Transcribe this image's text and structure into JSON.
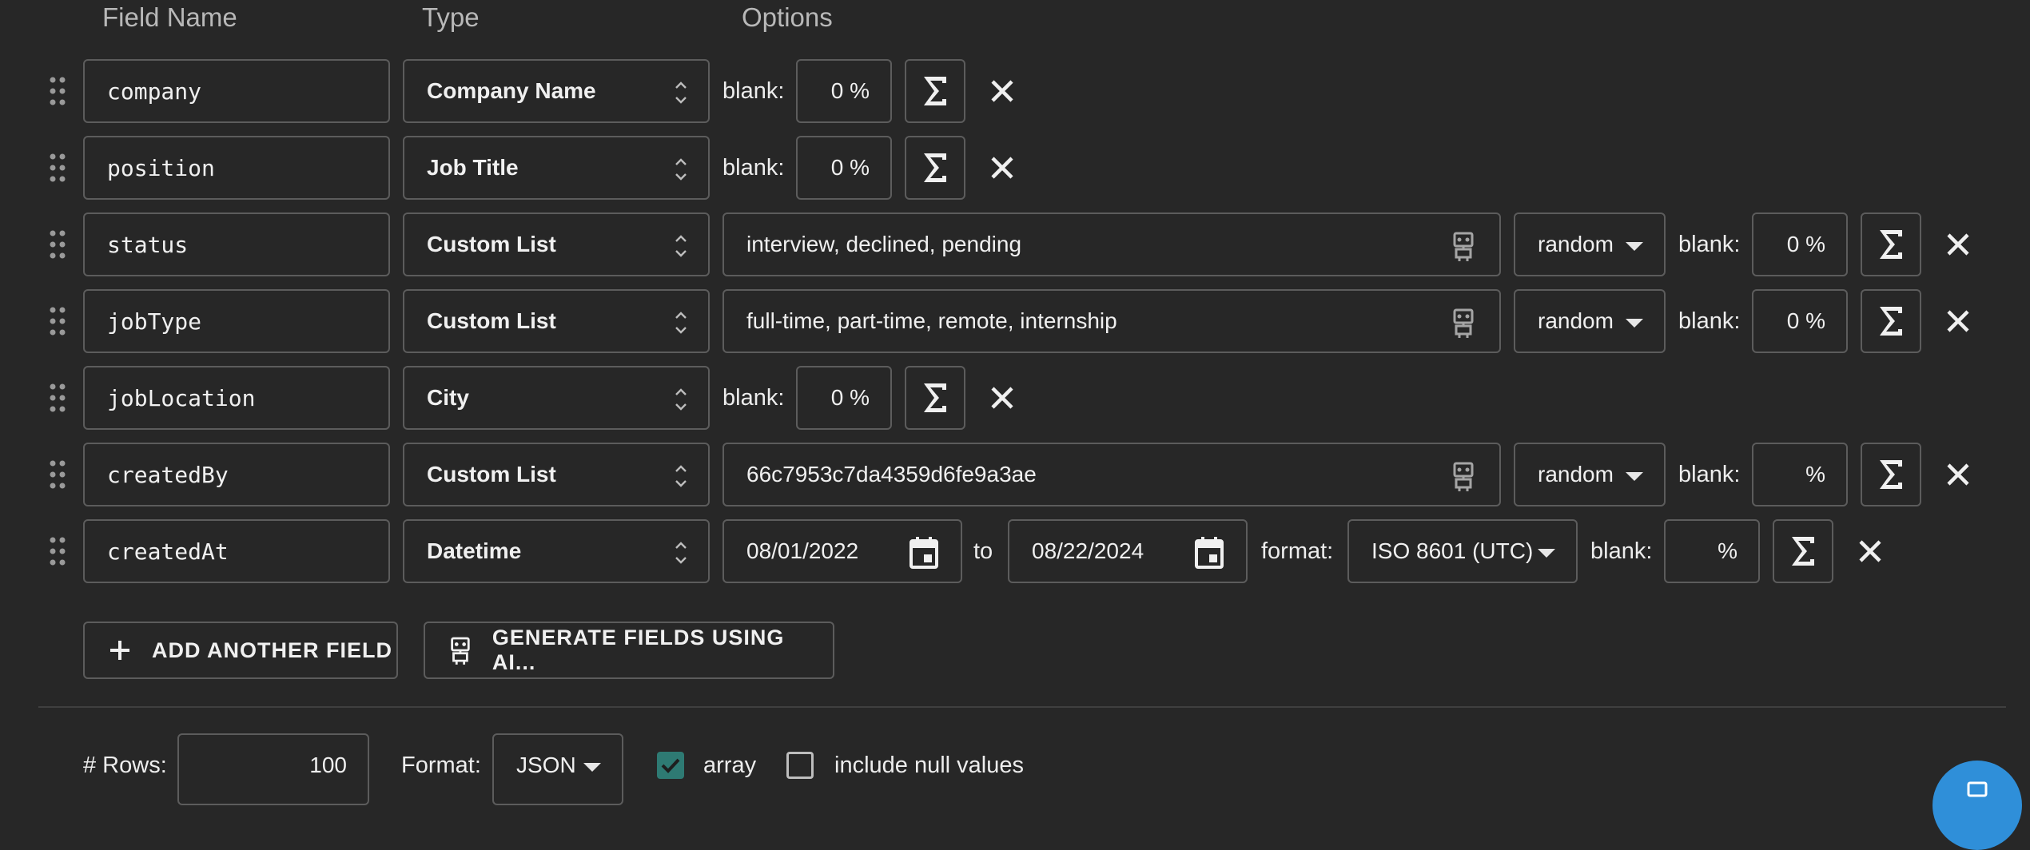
{
  "headers": {
    "field_name": "Field Name",
    "type": "Type",
    "options": "Options"
  },
  "labels": {
    "blank": "blank:",
    "to": "to",
    "format": "format:"
  },
  "fields": [
    {
      "name": "company",
      "type": "Company Name",
      "blank": "0 %"
    },
    {
      "name": "position",
      "type": "Job Title",
      "blank": "0 %"
    },
    {
      "name": "status",
      "type": "Custom List",
      "list": "interview, declined, pending",
      "order": "random",
      "blank": "0 %"
    },
    {
      "name": "jobType",
      "type": "Custom List",
      "list": "full-time, part-time, remote, internship",
      "order": "random",
      "blank": "0 %"
    },
    {
      "name": "jobLocation",
      "type": "City",
      "blank": "0 %"
    },
    {
      "name": "createdBy",
      "type": "Custom List",
      "list": "66c7953c7da4359d6fe9a3ae",
      "order": "random",
      "blank": "%"
    },
    {
      "name": "createdAt",
      "type": "Datetime",
      "from": "08/01/2022",
      "to": "08/22/2024",
      "format": "ISO 8601 (UTC)",
      "blank": "%"
    }
  ],
  "buttons": {
    "add_field": "ADD ANOTHER FIELD",
    "generate_ai": "GENERATE FIELDS USING AI..."
  },
  "footer": {
    "rows_label": "# Rows:",
    "rows_value": "100",
    "format_label": "Format:",
    "format_value": "JSON",
    "array_label": "array",
    "array_checked": true,
    "null_label": "include null values",
    "null_checked": false
  },
  "colors": {
    "background": "#272727",
    "border": "#5c5c5c",
    "checkbox_checked": "#2e7a73",
    "fab": "#2f8fd9"
  }
}
